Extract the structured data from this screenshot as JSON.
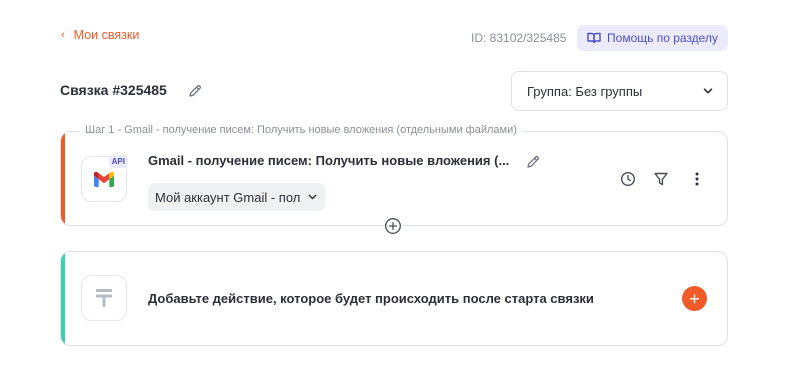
{
  "header": {
    "back_label": "Мои связки",
    "link_id": "ID: 83102/325485",
    "help_label": "Помощь по разделу"
  },
  "link": {
    "title": "Связка #325485"
  },
  "group_select": {
    "value": "Группа: Без группы"
  },
  "step": {
    "legend": "Шаг 1 - Gmail - получение писем: Получить новые вложения (отдельными файлами)",
    "name": "Gmail - получение писем: Получить новые вложения (...",
    "badge": "API",
    "account": "Мой аккаунт Gmail - пол",
    "tools": [
      "clock-icon",
      "filter-icon",
      "more-vertical-icon"
    ]
  },
  "add_action": {
    "text": "Добавьте действие, которое будет происходить после старта связки",
    "button": "+"
  },
  "colors": {
    "accent_orange": "#f05a2a",
    "accent_teal": "#3ecfb2",
    "help_bg": "#ecebfc",
    "help_text": "#4a4fc4",
    "border": "#dfe2e7"
  }
}
